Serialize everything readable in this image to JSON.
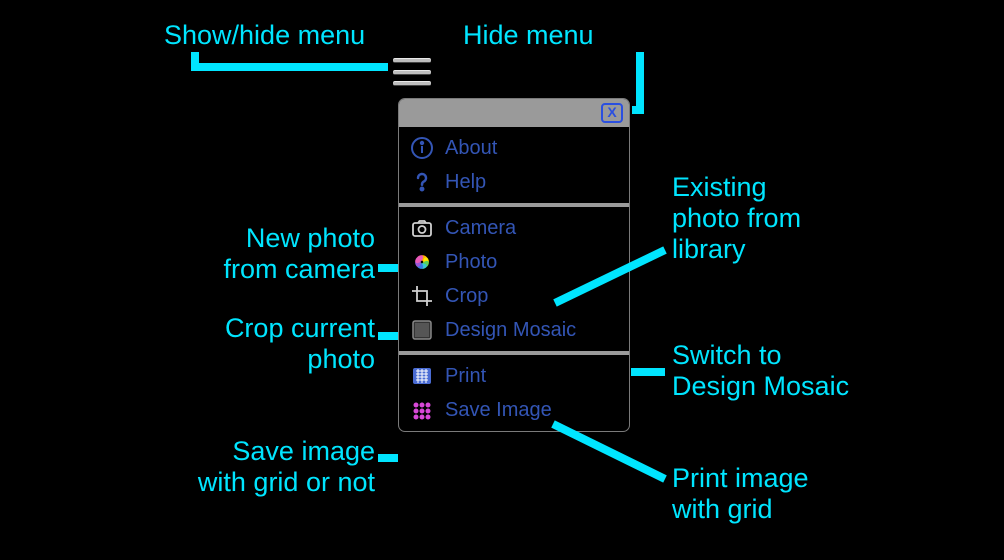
{
  "annotations": {
    "showHide": "Show/hide menu",
    "hideMenu": "Hide menu",
    "newPhoto1": "New photo",
    "newPhoto2": "from camera",
    "cropCurrent1": "Crop current",
    "cropCurrent2": "photo",
    "saveImage1": "Save image",
    "saveImage2": "with grid or not",
    "existing1": "Existing",
    "existing2": "photo from",
    "existing3": "library",
    "switch1": "Switch to",
    "switch2": "Design Mosaic",
    "print1": "Print image",
    "print2": "with grid"
  },
  "menu": {
    "about": "About",
    "help": "Help",
    "camera": "Camera",
    "photo": "Photo",
    "crop": "Crop",
    "designMosaic": "Design Mosaic",
    "print": "Print",
    "saveImage": "Save Image"
  },
  "colors": {
    "accent": "#00e5ff",
    "menuText": "#3355b5"
  }
}
